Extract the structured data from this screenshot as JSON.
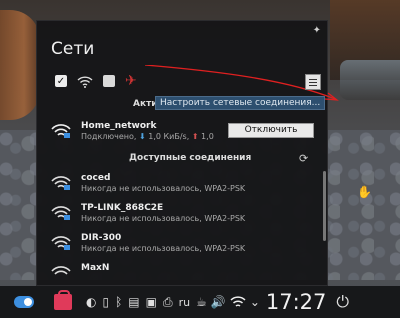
{
  "panel": {
    "title": "Сети",
    "active_header": "Акти",
    "tooltip": "Настроить сетевые соединения...",
    "available_header": "Доступные соединения",
    "disconnect_label": "Отключить"
  },
  "connected": {
    "name": "Home_network",
    "status": "Подключено, ",
    "down_arrow": "⬇",
    "down_rate": " 1,0 КиБ/s, ",
    "up_arrow": "⬆",
    "up_rate": " 1,0"
  },
  "networks": [
    {
      "name": "coced",
      "status": "Никогда не использовалось, WPA2-PSK"
    },
    {
      "name": "TP-LINK_868C2E",
      "status": "Никогда не использовалось, WPA2-PSK"
    },
    {
      "name": "DIR-300",
      "status": "Никогда не использовалось, WPA2-PSK"
    },
    {
      "name": "MaxN",
      "status": ""
    }
  ],
  "taskbar": {
    "layout": "ru",
    "clock": "17:27"
  },
  "colors": {
    "accent": "#3d8fe0",
    "airplane": "#c33333",
    "tooltip_bg": "#2d4f6f",
    "annotation": "#e02020"
  }
}
